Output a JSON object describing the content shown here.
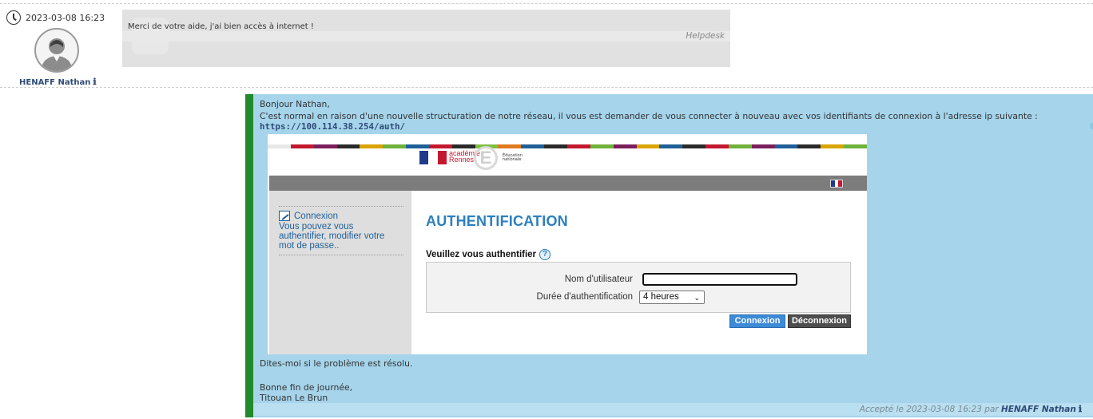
{
  "entry1": {
    "timestamp": "2023-03-08 16:23",
    "author": "HENAFF Nathan",
    "info_icon": "ℹ",
    "message": "Merci de votre aide, j'ai bien accès à internet !",
    "source_tag": "Helpdesk"
  },
  "entry2": {
    "greeting": "Bonjour Nathan,",
    "body_line": "C'est normal en raison d'une nouvelle structuration de notre réseau, il vous est demander de vous connecter à nouveau avec vos identifiants de connexion à l'adresse ip suivante :",
    "link": "https://100.114.38.254/auth/",
    "closing_question": "Dites-moi si le problème est résolu.",
    "signoff": "Bonne fin de journée,",
    "signature": "Titouan Le Brun",
    "accepted_prefix": "Accepté le 2023-03-08 16:23 par",
    "accepted_by": "HENAFF Nathan",
    "accepted_icon": "ℹ"
  },
  "embedded_login": {
    "logo_line1": "académie",
    "logo_line2": "Rennes",
    "logo_letter": "E",
    "logo_edu": "Éducation nationale",
    "sidebar_title": "Connexion",
    "sidebar_text": "Vous pouvez vous authentifier, modifier votre mot de passe..",
    "page_title": "AUTHENTIFICATION",
    "subtitle": "Veuillez vous authentifier",
    "help_glyph": "?",
    "username_label": "Nom d'utilisateur",
    "username_value": "",
    "duration_label": "Durée d'authentification",
    "duration_value": "4 heures",
    "chevron": "⌄",
    "connect_label": "Connexion",
    "disconnect_label": "Déconnexion"
  },
  "colors": {
    "accent_green": "#218a2a",
    "bubble_blue": "#a5d4eb",
    "link_blue": "#2e4a76",
    "auth_blue": "#2b7fbf"
  }
}
